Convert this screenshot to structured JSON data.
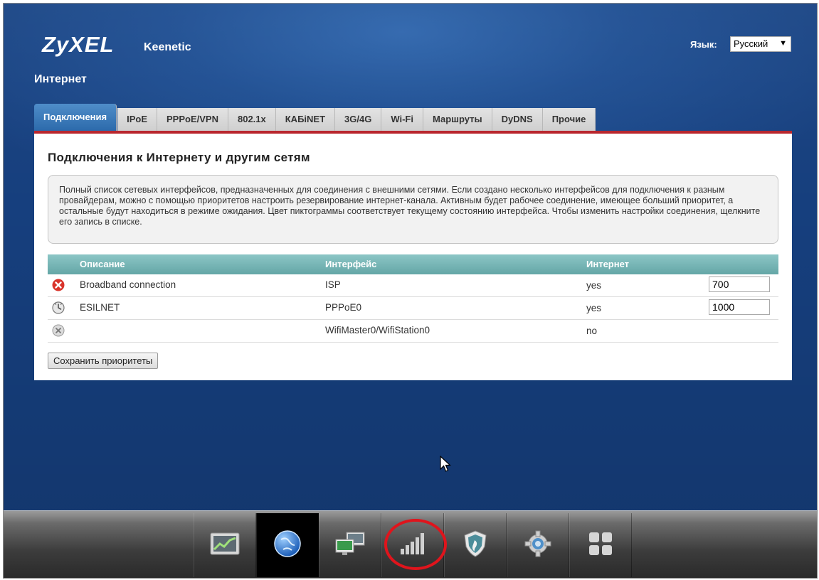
{
  "header": {
    "logo": "ZyXEL",
    "product": "Keenetic",
    "language_label": "Язык:",
    "language_value": "Русский",
    "page_title": "Интернет"
  },
  "tabs": [
    {
      "label": "Подключения",
      "active": true
    },
    {
      "label": "IPoE"
    },
    {
      "label": "PPPoE/VPN"
    },
    {
      "label": "802.1x"
    },
    {
      "label": "КАБiNET"
    },
    {
      "label": "3G/4G"
    },
    {
      "label": "Wi-Fi"
    },
    {
      "label": "Маршруты"
    },
    {
      "label": "DyDNS"
    },
    {
      "label": "Прочие"
    }
  ],
  "main": {
    "section_title": "Подключения к Интернету и другим сетям",
    "info": "Полный список сетевых интерфейсов, предназначенных для соединения с внешними сетями. Если создано несколько интерфейсов для подключения к разным провайдерам, можно с помощью приоритетов настроить резервирование интернет-канала. Активным будет рабочее соединение, имеющее больший приоритет, а остальные будут находиться в режиме ожидания. Цвет пиктограммы соответствует текущему состоянию интерфейса. Чтобы изменить настройки соединения, щелкните его запись в списке.",
    "table": {
      "headers": {
        "description": "Описание",
        "interface": "Интерфейс",
        "internet": "Интернет"
      },
      "rows": [
        {
          "status": "error-icon",
          "status_color": "#d9342b",
          "description": "Broadband connection",
          "interface": "ISP",
          "internet": "yes",
          "priority": "700"
        },
        {
          "status": "waiting-icon",
          "status_color": "#8d8d8d",
          "description": "ESILNET",
          "interface": "PPPoE0",
          "internet": "yes",
          "priority": "1000"
        },
        {
          "status": "disabled-icon",
          "status_color": "#b5b5b5",
          "description": "",
          "interface": "WifiMaster0/WifiStation0",
          "internet": "no",
          "priority": ""
        }
      ]
    },
    "save_button": "Сохранить приоритеты"
  },
  "dock": {
    "items": [
      {
        "icon": "monitor-chart-icon"
      },
      {
        "icon": "globe-icon",
        "active": true
      },
      {
        "icon": "network-computers-icon"
      },
      {
        "icon": "signal-bars-icon",
        "highlighted": true
      },
      {
        "icon": "shield-icon"
      },
      {
        "icon": "gear-icon"
      },
      {
        "icon": "apps-grid-icon"
      }
    ]
  },
  "colors": {
    "accent": "#2c6aab",
    "tab_underline": "#b9272e",
    "table_header": "#74b0b0",
    "highlight": "#e0141c"
  }
}
